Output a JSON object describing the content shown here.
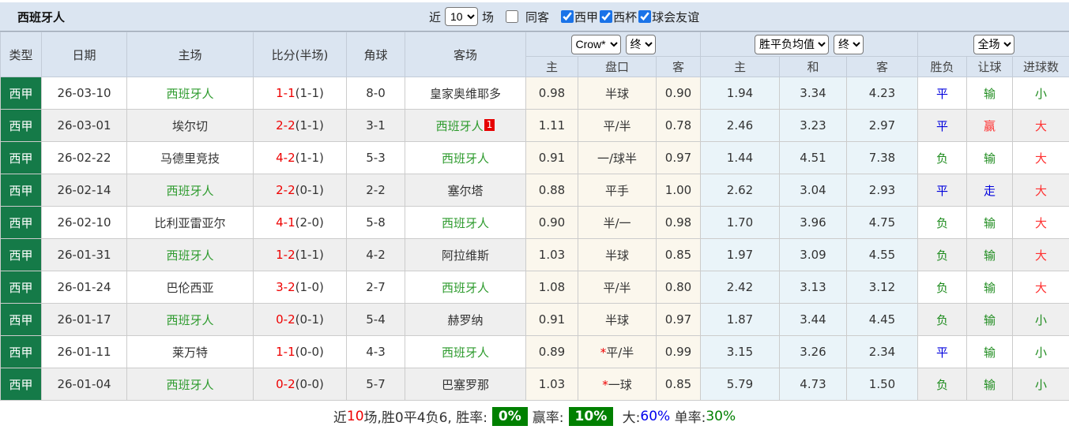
{
  "colors": {
    "league_cell_green": "#157A48",
    "team_name_green": "#2E9B2E",
    "score_red": "#EE0000",
    "result_blue": "#0000DD",
    "result_green": "#1F8C1F",
    "result_red": "#FF3030",
    "red_card_badge": "#E60000",
    "summary_badge_green": "#008000",
    "summary_big_blue": "#0000EE",
    "summary_single_green": "#008000",
    "header_bg": "#DBE5F1",
    "handicap_col_bg": "#FBF7ED",
    "avg_col_bg": "#EAF4F9",
    "alt_row_bg": "#EFEFEF",
    "checkbox_blue": "#1A73E8"
  },
  "title_bar": {
    "title": "西班牙人",
    "recent_label": "近",
    "recent_value": "10",
    "matches_label": "场",
    "same_away_label": "同客",
    "same_away_checked": false,
    "leagues": [
      {
        "label": "西甲",
        "checked": true
      },
      {
        "label": "西杯",
        "checked": true
      },
      {
        "label": "球会友谊",
        "checked": true
      }
    ]
  },
  "table_header": {
    "type": "类型",
    "date": "日期",
    "home": "主场",
    "score": "比分(半场)",
    "corner": "角球",
    "away": "客场",
    "bookmaker_select": "Crow*",
    "bookmaker_stage_select": "终",
    "avg_select": "胜平负均值",
    "avg_stage_select": "终",
    "scope_select": "全场",
    "sub_home": "主",
    "sub_handicap": "盘口",
    "sub_away": "客",
    "sub_avg_win": "主",
    "sub_avg_draw": "和",
    "sub_avg_lose": "客",
    "sub_result": "胜负",
    "sub_let": "让球",
    "sub_goals": "进球数"
  },
  "rows": [
    {
      "type": "西甲",
      "date": "26-03-10",
      "home": "西班牙人",
      "home_class": "team",
      "score": "1-1",
      "half": "(1-1)",
      "corner": "8-0",
      "away": "皇家奥维耶多",
      "away_class": "",
      "away_badge": "",
      "home_odds": "0.98",
      "handicap_star": "",
      "handicap": "半球",
      "away_odds": "0.90",
      "avg_win": "1.94",
      "avg_draw": "3.34",
      "avg_lose": "4.23",
      "result": "平",
      "result_class": "blue",
      "let_result": "输",
      "let_class": "green",
      "goals": "小",
      "goals_class": "green"
    },
    {
      "type": "西甲",
      "date": "26-03-01",
      "home": "埃尔切",
      "home_class": "",
      "score": "2-2",
      "half": "(1-1)",
      "corner": "3-1",
      "away": "西班牙人",
      "away_class": "team",
      "away_badge": "1",
      "home_odds": "1.11",
      "handicap_star": "",
      "handicap": "平/半",
      "away_odds": "0.78",
      "avg_win": "2.46",
      "avg_draw": "3.23",
      "avg_lose": "2.97",
      "result": "平",
      "result_class": "blue",
      "let_result": "赢",
      "let_class": "red",
      "goals": "大",
      "goals_class": "red"
    },
    {
      "type": "西甲",
      "date": "26-02-22",
      "home": "马德里竞技",
      "home_class": "",
      "score": "4-2",
      "half": "(1-1)",
      "corner": "5-3",
      "away": "西班牙人",
      "away_class": "team",
      "away_badge": "",
      "home_odds": "0.91",
      "handicap_star": "",
      "handicap": "一/球半",
      "away_odds": "0.97",
      "avg_win": "1.44",
      "avg_draw": "4.51",
      "avg_lose": "7.38",
      "result": "负",
      "result_class": "green",
      "let_result": "输",
      "let_class": "green",
      "goals": "大",
      "goals_class": "red"
    },
    {
      "type": "西甲",
      "date": "26-02-14",
      "home": "西班牙人",
      "home_class": "team",
      "score": "2-2",
      "half": "(0-1)",
      "corner": "2-2",
      "away": "塞尔塔",
      "away_class": "",
      "away_badge": "",
      "home_odds": "0.88",
      "handicap_star": "",
      "handicap": "平手",
      "away_odds": "1.00",
      "avg_win": "2.62",
      "avg_draw": "3.04",
      "avg_lose": "2.93",
      "result": "平",
      "result_class": "blue",
      "let_result": "走",
      "let_class": "blue",
      "goals": "大",
      "goals_class": "red"
    },
    {
      "type": "西甲",
      "date": "26-02-10",
      "home": "比利亚雷亚尔",
      "home_class": "",
      "score": "4-1",
      "half": "(2-0)",
      "corner": "5-8",
      "away": "西班牙人",
      "away_class": "team",
      "away_badge": "",
      "home_odds": "0.90",
      "handicap_star": "",
      "handicap": "半/一",
      "away_odds": "0.98",
      "avg_win": "1.70",
      "avg_draw": "3.96",
      "avg_lose": "4.75",
      "result": "负",
      "result_class": "green",
      "let_result": "输",
      "let_class": "green",
      "goals": "大",
      "goals_class": "red"
    },
    {
      "type": "西甲",
      "date": "26-01-31",
      "home": "西班牙人",
      "home_class": "team",
      "score": "1-2",
      "half": "(1-1)",
      "corner": "4-2",
      "away": "阿拉维斯",
      "away_class": "",
      "away_badge": "",
      "home_odds": "1.03",
      "handicap_star": "",
      "handicap": "半球",
      "away_odds": "0.85",
      "avg_win": "1.97",
      "avg_draw": "3.09",
      "avg_lose": "4.55",
      "result": "负",
      "result_class": "green",
      "let_result": "输",
      "let_class": "green",
      "goals": "大",
      "goals_class": "red"
    },
    {
      "type": "西甲",
      "date": "26-01-24",
      "home": "巴伦西亚",
      "home_class": "",
      "score": "3-2",
      "half": "(1-0)",
      "corner": "2-7",
      "away": "西班牙人",
      "away_class": "team",
      "away_badge": "",
      "home_odds": "1.08",
      "handicap_star": "",
      "handicap": "平/半",
      "away_odds": "0.80",
      "avg_win": "2.42",
      "avg_draw": "3.13",
      "avg_lose": "3.12",
      "result": "负",
      "result_class": "green",
      "let_result": "输",
      "let_class": "green",
      "goals": "大",
      "goals_class": "red"
    },
    {
      "type": "西甲",
      "date": "26-01-17",
      "home": "西班牙人",
      "home_class": "team",
      "score": "0-2",
      "half": "(0-1)",
      "corner": "5-4",
      "away": "赫罗纳",
      "away_class": "",
      "away_badge": "",
      "home_odds": "0.91",
      "handicap_star": "",
      "handicap": "半球",
      "away_odds": "0.97",
      "avg_win": "1.87",
      "avg_draw": "3.44",
      "avg_lose": "4.45",
      "result": "负",
      "result_class": "green",
      "let_result": "输",
      "let_class": "green",
      "goals": "小",
      "goals_class": "green"
    },
    {
      "type": "西甲",
      "date": "26-01-11",
      "home": "莱万特",
      "home_class": "",
      "score": "1-1",
      "half": "(0-0)",
      "corner": "4-3",
      "away": "西班牙人",
      "away_class": "team",
      "away_badge": "",
      "home_odds": "0.89",
      "handicap_star": "*",
      "handicap": "平/半",
      "away_odds": "0.99",
      "avg_win": "3.15",
      "avg_draw": "3.26",
      "avg_lose": "2.34",
      "result": "平",
      "result_class": "blue",
      "let_result": "输",
      "let_class": "green",
      "goals": "小",
      "goals_class": "green"
    },
    {
      "type": "西甲",
      "date": "26-01-04",
      "home": "西班牙人",
      "home_class": "team",
      "score": "0-2",
      "half": "(0-0)",
      "corner": "5-7",
      "away": "巴塞罗那",
      "away_class": "",
      "away_badge": "",
      "home_odds": "1.03",
      "handicap_star": "*",
      "handicap": "一球",
      "away_odds": "0.85",
      "avg_win": "5.79",
      "avg_draw": "4.73",
      "avg_lose": "1.50",
      "result": "负",
      "result_class": "green",
      "let_result": "输",
      "let_class": "green",
      "goals": "小",
      "goals_class": "green"
    }
  ],
  "summary": {
    "prefix": "近",
    "count": "10",
    "record": "场,胜0平4负6, 胜率:",
    "win_rate_badge": "0%",
    "profit_label": "赢率:",
    "profit_badge": "10%",
    "big_label": " 大:",
    "big_value": "60%",
    "single_label": " 单率:",
    "single_value": "30%"
  }
}
